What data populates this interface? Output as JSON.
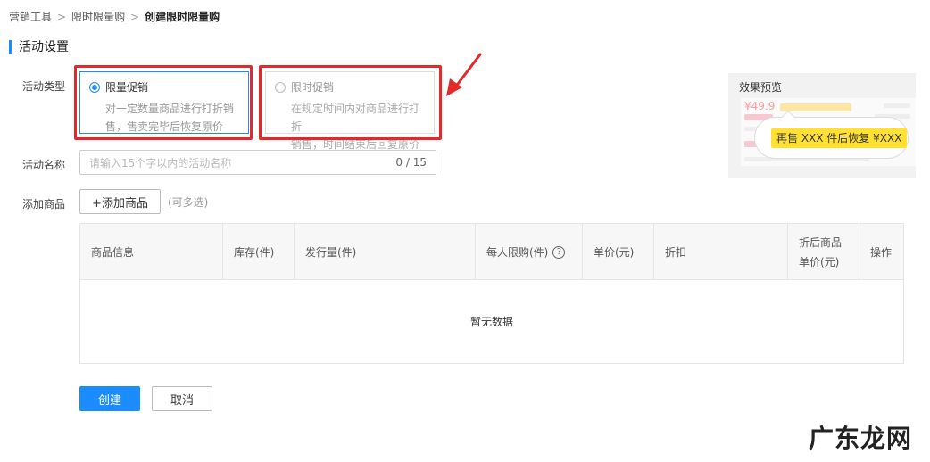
{
  "breadcrumb": {
    "items": [
      "营销工具",
      "限时限量购"
    ],
    "current": "创建限时限量购",
    "separator": ">"
  },
  "section_title": "活动设置",
  "activity_type": {
    "label": "活动类型",
    "options": [
      {
        "title": "限量促销",
        "desc_line1": "对一定数量商品进行打折销",
        "desc_line2": "售，售卖完毕后恢复原价",
        "selected": true
      },
      {
        "title": "限时促销",
        "desc_line1": "在规定时间内对商品进行打折",
        "desc_line2": "销售，时间结束后回复原价",
        "selected": false
      }
    ]
  },
  "activity_name": {
    "label": "活动名称",
    "placeholder": "请输入15个字以内的活动名称",
    "counter": "0 / 15"
  },
  "add_product": {
    "label": "添加商品",
    "button": "+添加商品",
    "hint": "(可多选)"
  },
  "table": {
    "columns": [
      "商品信息",
      "库存(件)",
      "发行量(件)",
      "每人限购(件)",
      "单价(元)",
      "折扣",
      "折后商品单价(元)",
      "操作"
    ],
    "discount_price_line1": "折后商品",
    "discount_price_line2": "单价(元)",
    "empty_text": "暂无数据"
  },
  "actions": {
    "create": "创建",
    "cancel": "取消"
  },
  "preview": {
    "title": "效果预览",
    "price": "¥49.9",
    "tooltip": "再售 XXX 件后恢复 ¥XXX"
  },
  "watermark": "广东龙网",
  "colors": {
    "accent": "#1a8cff",
    "highlight": "#e4292a",
    "tooltip_bg": "#ffe033"
  }
}
